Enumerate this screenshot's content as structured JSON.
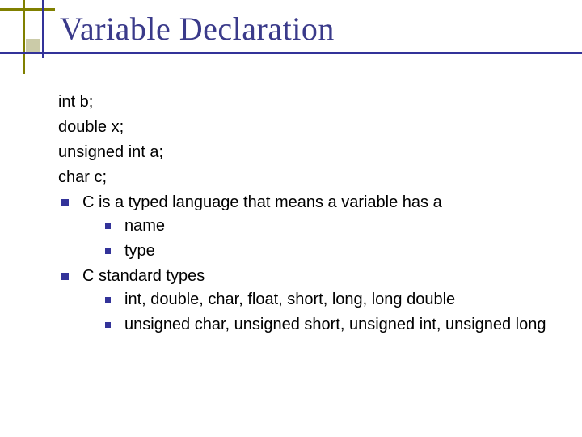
{
  "title": "Variable Declaration",
  "code": {
    "l1": "int b;",
    "l2": "double x;",
    "l3": "unsigned int a;",
    "l4": "char c;"
  },
  "bullets": {
    "b1": {
      "text": "C is a typed language that means a variable has a",
      "sub": {
        "s1": "name",
        "s2": "type"
      }
    },
    "b2": {
      "text": "C standard types",
      "sub": {
        "s1": "int, double, char, float, short, long, long double",
        "s2": "unsigned char, unsigned short, unsigned int, unsigned long"
      }
    }
  }
}
